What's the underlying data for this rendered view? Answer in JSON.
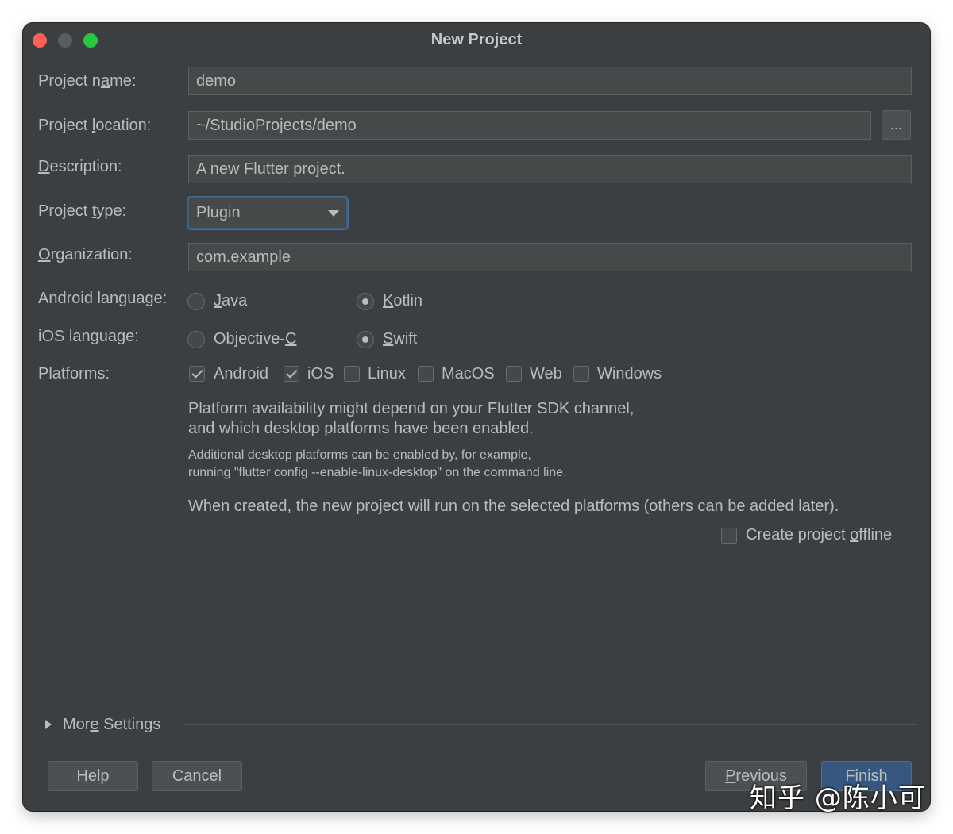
{
  "window": {
    "title": "New Project"
  },
  "form": {
    "project_name": {
      "label_pre": "Project n",
      "label_u": "a",
      "label_post": "me:",
      "value": "demo"
    },
    "project_location": {
      "label_pre": "Project ",
      "label_u": "l",
      "label_post": "ocation:",
      "value": "~/StudioProjects/demo",
      "browse_label": "..."
    },
    "description": {
      "label_pre": "",
      "label_u": "D",
      "label_post": "escription:",
      "value": "A new Flutter project."
    },
    "project_type": {
      "label_pre": "Project ",
      "label_u": "t",
      "label_post": "ype:",
      "value": "Plugin"
    },
    "organization": {
      "label_pre": "",
      "label_u": "O",
      "label_post": "rganization:",
      "value": "com.example"
    },
    "android_language": {
      "label": "Android language:",
      "options": [
        {
          "pre": "",
          "u": "J",
          "post": "ava",
          "selected": false
        },
        {
          "pre": "",
          "u": "K",
          "post": "otlin",
          "selected": true
        }
      ]
    },
    "ios_language": {
      "label": "iOS language:",
      "options": [
        {
          "pre": "Objective-",
          "u": "C",
          "post": "",
          "selected": false
        },
        {
          "pre": "",
          "u": "S",
          "post": "wift",
          "selected": true
        }
      ]
    },
    "platforms": {
      "label": "Platforms:",
      "items": [
        {
          "label": "Android",
          "checked": true
        },
        {
          "label": "iOS",
          "checked": true
        },
        {
          "label": "Linux",
          "checked": false
        },
        {
          "label": "MacOS",
          "checked": false
        },
        {
          "label": "Web",
          "checked": false
        },
        {
          "label": "Windows",
          "checked": false
        }
      ]
    },
    "platform_note_line1": "Platform availability might depend on your Flutter SDK channel,",
    "platform_note_line2": "and which desktop platforms have been enabled.",
    "platform_small_line1": "Additional desktop platforms can be enabled by, for example,",
    "platform_small_line2": "running \"flutter config --enable-linux-desktop\" on the command line.",
    "created_note": "When created, the new project will run on the selected platforms (others can be added later).",
    "offline": {
      "pre": "Create project ",
      "u": "o",
      "post": "ffline",
      "checked": false
    }
  },
  "more_settings": {
    "pre": "Mor",
    "u": "e",
    "post": " Settings"
  },
  "buttons": {
    "help": "Help",
    "cancel": "Cancel",
    "previous_pre": "",
    "previous_u": "P",
    "previous_post": "revious",
    "finish": "Finish"
  },
  "watermark": "知乎 @陈小可"
}
